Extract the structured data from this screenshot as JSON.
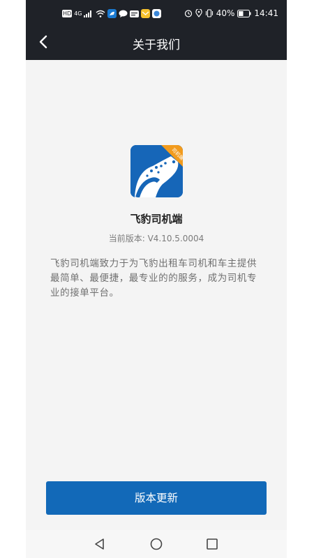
{
  "status_bar": {
    "left_badges": [
      "HD",
      "4G",
      "",
      "",
      "",
      "",
      "",
      "",
      ""
    ],
    "battery_percent": "40%",
    "time": "14:41"
  },
  "header": {
    "title": "关于我们",
    "back_icon": "chevron-left-icon"
  },
  "app": {
    "icon": "cheetah-logo",
    "badge_text": "司机端",
    "name": "飞豹司机端",
    "version_label": "当前版本:",
    "version_value": "V4.10.5.0004",
    "brand_color": "#1666b8",
    "badge_color": "#f29b1d"
  },
  "description": "飞豹司机端致力于为飞豹出租车司机和车主提供最简单、最便捷，最专业的的服务，成为司机专业的接单平台。",
  "update_button": {
    "label": "版本更新",
    "color": "#1269b8"
  },
  "nav_bar": {
    "back": "triangle-back-icon",
    "home": "circle-home-icon",
    "recents": "square-recents-icon"
  }
}
